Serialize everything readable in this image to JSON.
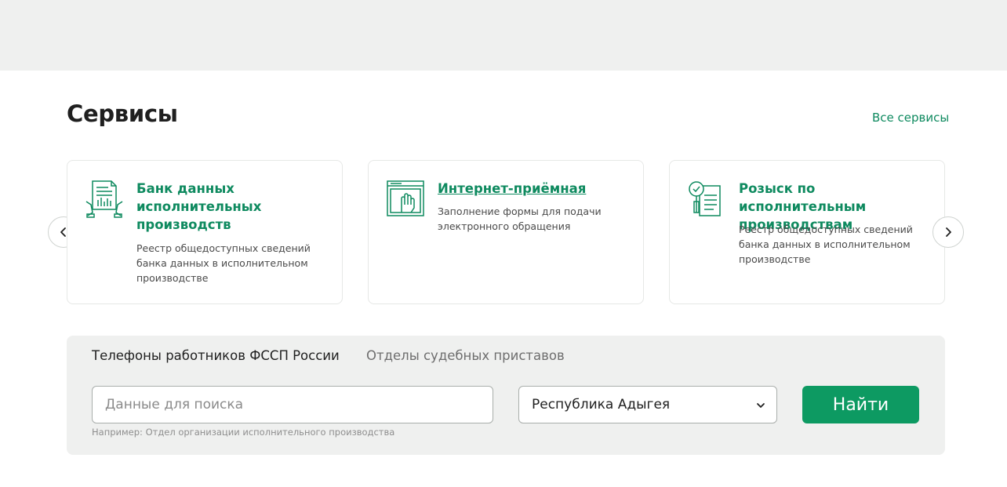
{
  "section": {
    "title": "Сервисы",
    "all_link": "Все сервисы"
  },
  "cards": [
    {
      "title": "Банк данных исполнительных производств",
      "desc": "Реестр общедоступных сведений банка данных в исполнительном производстве",
      "icon": "document-hands-icon"
    },
    {
      "title": "Интернет-приёмная",
      "desc": "Заполнение формы для подачи электронного обращения",
      "icon": "browser-hand-icon"
    },
    {
      "title": "Розыск по исполнительным производствам",
      "desc": "Реестр общедоступных сведений банка данных в исполнительном производстве",
      "icon": "search-document-icon"
    }
  ],
  "search": {
    "tabs": [
      "Телефоны работников ФССП России",
      "Отделы судебных приставов"
    ],
    "active_tab": "Телефоны работников ФССП России",
    "placeholder": "Данные для поиска",
    "value": "",
    "hint": "Например: Отдел организации исполнительного производства",
    "region": "Республика Адыгея",
    "button": "Найти"
  },
  "colors": {
    "accent": "#0e8a5f",
    "button": "#0d9a62",
    "panel": "#eff0ef"
  }
}
